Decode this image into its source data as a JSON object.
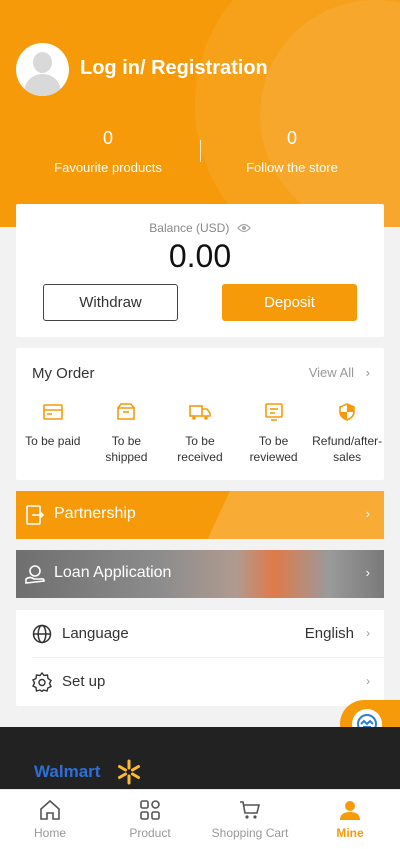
{
  "header": {
    "title": "Log in/ Registration",
    "stats": [
      {
        "value": "0",
        "label": "Favourite products"
      },
      {
        "value": "0",
        "label": "Follow the store"
      }
    ]
  },
  "balance": {
    "label": "Balance",
    "currency": "(USD)",
    "amount": "0.00",
    "withdraw_label": "Withdraw",
    "deposit_label": "Deposit"
  },
  "orders": {
    "title": "My Order",
    "view_all": "View All",
    "items": [
      {
        "label": "To be paid",
        "icon": "wallet-icon"
      },
      {
        "label": "To be shipped",
        "icon": "box-icon"
      },
      {
        "label": "To be received",
        "icon": "truck-icon"
      },
      {
        "label": "To be reviewed",
        "icon": "review-icon"
      },
      {
        "label": "Refund/after-sales",
        "icon": "shield-icon"
      }
    ]
  },
  "banners": {
    "partnership": "Partnership",
    "loan": "Loan Application"
  },
  "settings": {
    "language_label": "Language",
    "language_value": "English",
    "setup_label": "Set up"
  },
  "footer": {
    "brand": "Walmart"
  },
  "nav": [
    {
      "label": "Home",
      "icon": "home-icon"
    },
    {
      "label": "Product",
      "icon": "grid-icon"
    },
    {
      "label": "Shopping Cart",
      "icon": "cart-icon"
    },
    {
      "label": "Mine",
      "icon": "user-icon",
      "active": true
    }
  ],
  "colors": {
    "accent": "#f79a0a",
    "background": "#f2f2f2",
    "footer": "#222222"
  }
}
